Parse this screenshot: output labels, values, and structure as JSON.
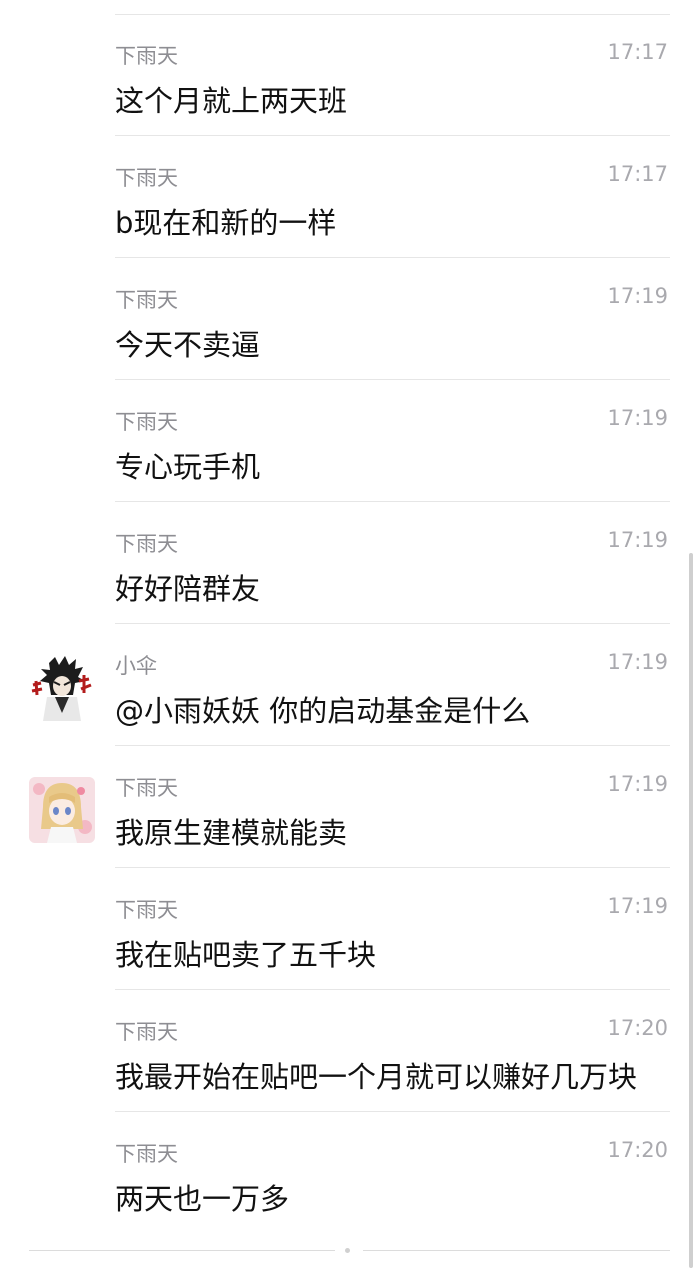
{
  "messages": [
    {
      "sender": "下雨天",
      "time": "17:17",
      "text": "这个月就上两天班",
      "avatar": null
    },
    {
      "sender": "下雨天",
      "time": "17:17",
      "text": "b现在和新的一样",
      "avatar": null
    },
    {
      "sender": "下雨天",
      "time": "17:19",
      "text": "今天不卖逼",
      "avatar": null
    },
    {
      "sender": "下雨天",
      "time": "17:19",
      "text": "专心玩手机",
      "avatar": null
    },
    {
      "sender": "下雨天",
      "time": "17:19",
      "text": "好好陪群友",
      "avatar": null
    },
    {
      "sender": "小伞",
      "time": "17:19",
      "text": "@小雨妖妖 你的启动基金是什么",
      "avatar": "anime-boy-avatar"
    },
    {
      "sender": "下雨天",
      "time": "17:19",
      "text": "我原生建模就能卖",
      "avatar": "anime-girl-avatar"
    },
    {
      "sender": "下雨天",
      "time": "17:19",
      "text": "我在贴吧卖了五千块",
      "avatar": null
    },
    {
      "sender": "下雨天",
      "time": "17:20",
      "text": "我最开始在贴吧一个月就可以赚好几万块",
      "avatar": null
    },
    {
      "sender": "下雨天",
      "time": "17:20",
      "text": "两天也一万多",
      "avatar": null
    }
  ],
  "colors": {
    "sender": "#8e8e93",
    "time": "#a9a9ae",
    "message": "#111111",
    "divider": "#e6e6e6"
  }
}
